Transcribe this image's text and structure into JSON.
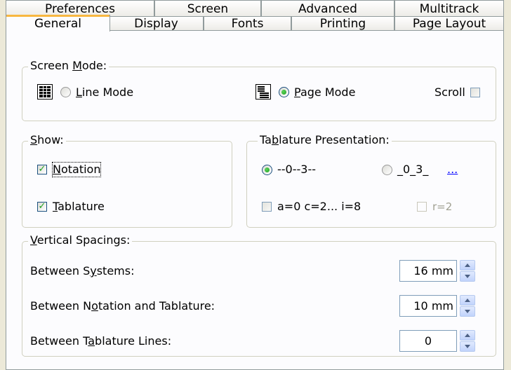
{
  "tabs_row1": [
    "Preferences",
    "Screen",
    "Advanced",
    "Multitrack"
  ],
  "tabs_row2": [
    "General",
    "Display",
    "Fonts",
    "Printing",
    "Page Layout"
  ],
  "active_tab": "General",
  "screen_mode": {
    "legend_pre": "Screen ",
    "legend_key": "M",
    "legend_post": "ode:",
    "line_mode": {
      "key": "L",
      "rest": "ine Mode",
      "selected": false
    },
    "page_mode": {
      "key": "P",
      "rest": "age Mode",
      "selected": true
    },
    "scroll_label": "Scroll",
    "scroll_checked": false
  },
  "show": {
    "legend_key": "S",
    "legend_post": "how:",
    "notation": {
      "key": "N",
      "rest": "otation",
      "checked": true
    },
    "tablature": {
      "key": "T",
      "rest": "ablature",
      "checked": true
    }
  },
  "tablature_presentation": {
    "legend_pre": "Ta",
    "legend_key": "b",
    "legend_post": "lature Presentation:",
    "option1": {
      "label": "--0--3--",
      "selected": true
    },
    "option2": {
      "label": "_0_3_",
      "selected": false
    },
    "more_link": "...",
    "abc_label": "a=0 c=2... i=8",
    "abc_checked": false,
    "r2_label": "r=2",
    "r2_enabled": false
  },
  "vertical_spacings": {
    "legend_key": "V",
    "legend_post": "ertical Spacings:",
    "rows": [
      {
        "pre": "Between S",
        "key": "y",
        "post": "stems:",
        "value": "16 mm"
      },
      {
        "pre": "Between N",
        "key": "o",
        "post": "tation and Tablature:",
        "value": "10 mm"
      },
      {
        "pre": "Between T",
        "key": "a",
        "post": "blature Lines:",
        "value": "0"
      }
    ]
  },
  "colors": {
    "dialog_bg": "#ece9d8",
    "page_bg": "#fcfcfe",
    "check_green": "#21a121",
    "link_blue": "#0000ff"
  }
}
